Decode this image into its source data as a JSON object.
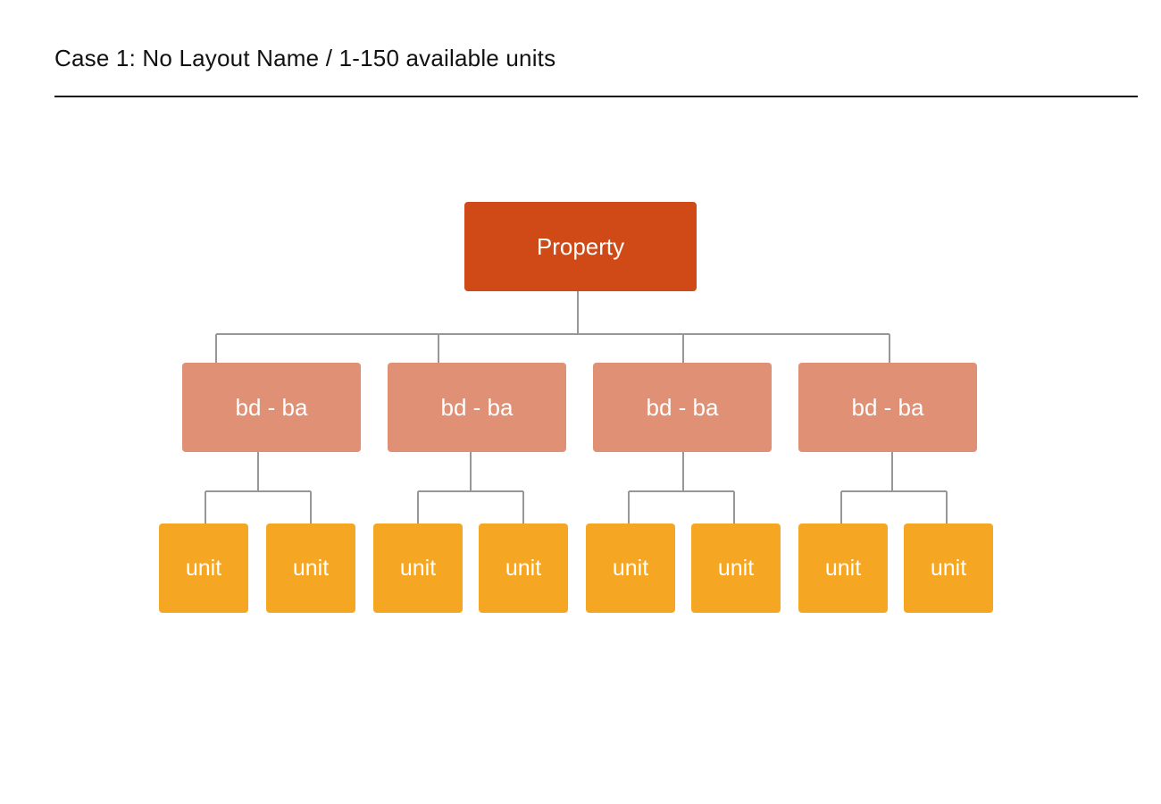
{
  "header": {
    "title": "Case 1: No Layout Name / 1-150 available units"
  },
  "colors": {
    "root": "#d04a17",
    "group": "#e09074",
    "unit": "#f5a623",
    "connector": "#979797"
  },
  "tree": {
    "label": "Property",
    "children": [
      {
        "label": "bd - ba",
        "children": [
          {
            "label": "unit"
          },
          {
            "label": "unit"
          }
        ]
      },
      {
        "label": "bd - ba",
        "children": [
          {
            "label": "unit"
          },
          {
            "label": "unit"
          }
        ]
      },
      {
        "label": "bd - ba",
        "children": [
          {
            "label": "unit"
          },
          {
            "label": "unit"
          }
        ]
      },
      {
        "label": "bd - ba",
        "children": [
          {
            "label": "unit"
          },
          {
            "label": "unit"
          }
        ]
      }
    ]
  }
}
